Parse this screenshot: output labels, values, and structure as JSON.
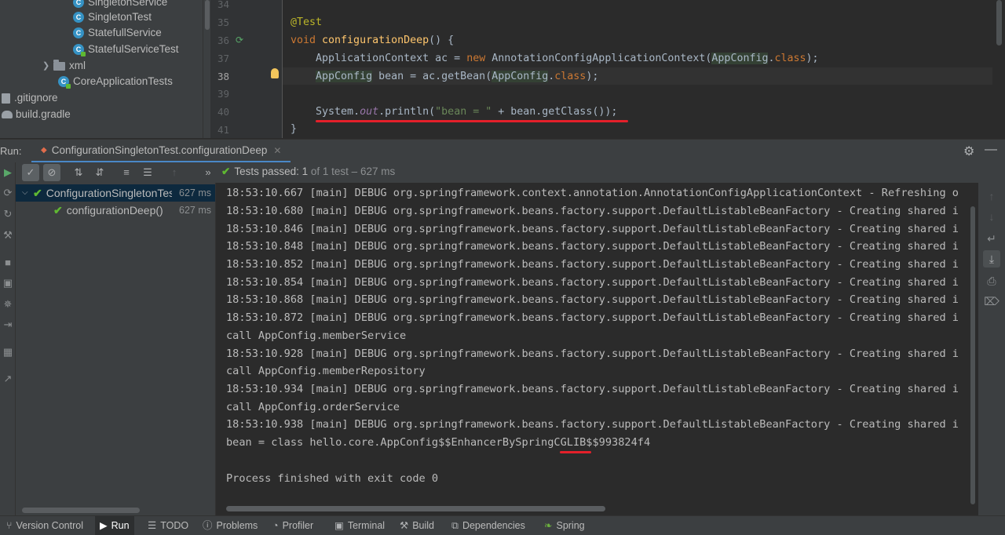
{
  "project_tree": {
    "items": [
      {
        "label": "SingletonService",
        "icon": "class-icon"
      },
      {
        "label": "SingletonTest",
        "icon": "class-icon"
      },
      {
        "label": "StatefullService",
        "icon": "class-icon"
      },
      {
        "label": "StatefulServiceTest",
        "icon": "class-test-icon"
      },
      {
        "label": "xml",
        "icon": "folder-icon"
      },
      {
        "label": "CoreApplicationTests",
        "icon": "class-test-icon"
      },
      {
        "label": ".gitignore",
        "icon": "file-icon"
      },
      {
        "label": "build.gradle",
        "icon": "gradle-icon"
      }
    ]
  },
  "editor": {
    "line_numbers": [
      "34",
      "35",
      "36",
      "37",
      "38",
      "39",
      "40",
      "41"
    ],
    "current_line": "38",
    "code": {
      "l35_annotation": "@Test",
      "l36_void": "void ",
      "l36_method": "configurationDeep",
      "l36_rest": "() {",
      "l37_type": "ApplicationContext",
      "l37_var": " ac = ",
      "l37_new": "new ",
      "l37_ctor": "AnnotationConfigApplicationContext(",
      "l37_cls": "AppConfig",
      "l37_dot": ".",
      "l37_class_kw": "class",
      "l37_end": ");",
      "l38_type": "AppConfig",
      "l38_mid": " bean = ac.getBean(",
      "l38_cls": "AppConfig",
      "l38_dot": ".",
      "l38_class_kw": "class",
      "l38_end": ");",
      "l40_sys": "System.",
      "l40_out": "out",
      "l40_println": ".println(",
      "l40_str": "\"bean = \"",
      "l40_rest": " + bean.getClass());",
      "l41_brace": "}"
    }
  },
  "run_window": {
    "label": "Run:",
    "tab_title": "ConfigurationSingletonTest.configurationDeep",
    "tests_passed_label": "Tests passed:",
    "tests_passed_count": "1",
    "tests_passed_detail": "of 1 test – 627 ms",
    "test_tree": [
      {
        "name": "ConfigurationSingletonTest",
        "duration": "627 ms"
      },
      {
        "name": "configurationDeep()",
        "duration": "627 ms"
      }
    ],
    "console_lines": [
      "18:53:10.667 [main] DEBUG org.springframework.context.annotation.AnnotationConfigApplicationContext - Refreshing o",
      "18:53:10.680 [main] DEBUG org.springframework.beans.factory.support.DefaultListableBeanFactory - Creating shared i",
      "18:53:10.846 [main] DEBUG org.springframework.beans.factory.support.DefaultListableBeanFactory - Creating shared i",
      "18:53:10.848 [main] DEBUG org.springframework.beans.factory.support.DefaultListableBeanFactory - Creating shared i",
      "18:53:10.852 [main] DEBUG org.springframework.beans.factory.support.DefaultListableBeanFactory - Creating shared i",
      "18:53:10.854 [main] DEBUG org.springframework.beans.factory.support.DefaultListableBeanFactory - Creating shared i",
      "18:53:10.868 [main] DEBUG org.springframework.beans.factory.support.DefaultListableBeanFactory - Creating shared i",
      "18:53:10.872 [main] DEBUG org.springframework.beans.factory.support.DefaultListableBeanFactory - Creating shared i",
      "call AppConfig.memberService",
      "18:53:10.928 [main] DEBUG org.springframework.beans.factory.support.DefaultListableBeanFactory - Creating shared i",
      "call AppConfig.memberRepository",
      "18:53:10.934 [main] DEBUG org.springframework.beans.factory.support.DefaultListableBeanFactory - Creating shared i",
      "call AppConfig.orderService",
      "18:53:10.938 [main] DEBUG org.springframework.beans.factory.support.DefaultListableBeanFactory - Creating shared i",
      "bean = class hello.core.AppConfig$$EnhancerBySpringCGLIB$$993824f4",
      "",
      "Process finished with exit code 0"
    ]
  },
  "bottom_bar": {
    "items": [
      {
        "label": "Version Control",
        "icon": "branch-icon"
      },
      {
        "label": "Run",
        "icon": "run-icon"
      },
      {
        "label": "TODO",
        "icon": "list-icon"
      },
      {
        "label": "Problems",
        "icon": "problems-icon"
      },
      {
        "label": "Profiler",
        "icon": "profiler-icon"
      },
      {
        "label": "Terminal",
        "icon": "terminal-icon"
      },
      {
        "label": "Build",
        "icon": "hammer-icon"
      },
      {
        "label": "Dependencies",
        "icon": "dependencies-icon"
      },
      {
        "label": "Spring",
        "icon": "spring-icon"
      }
    ]
  },
  "colors": {
    "highlight_underline": "#e4202a",
    "pass_green": "#5fb832",
    "editor_bg": "#2b2b2b",
    "panel_bg": "#3c3f41"
  }
}
